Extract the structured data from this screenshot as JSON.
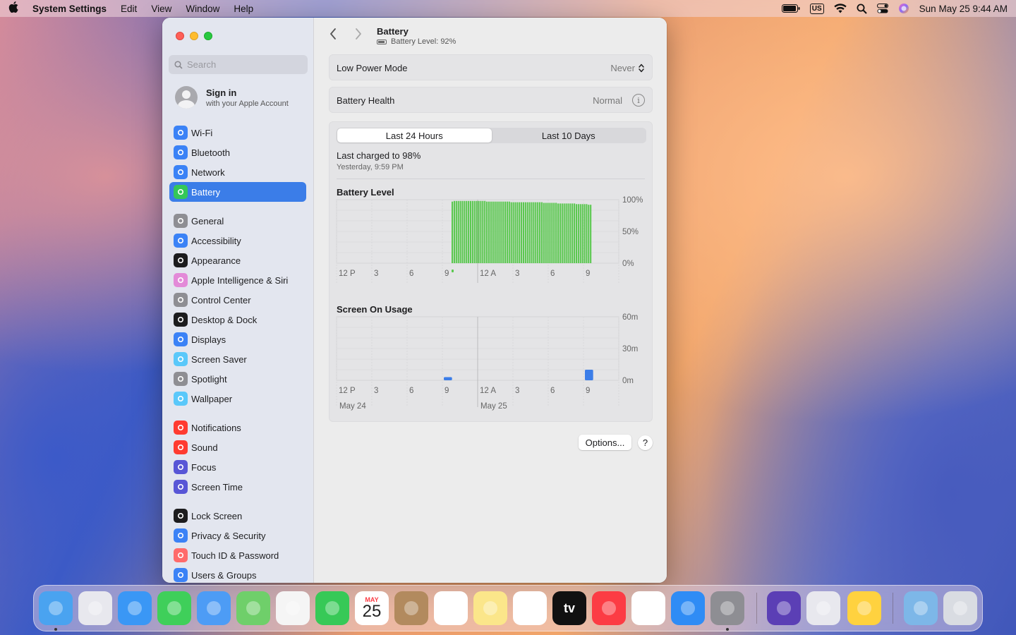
{
  "menubar": {
    "app_name": "System Settings",
    "menus": [
      "Edit",
      "View",
      "Window",
      "Help"
    ],
    "input_source": "US",
    "datetime": "Sun May 25  9:44 AM"
  },
  "sidebar": {
    "search_placeholder": "Search",
    "signin_title": "Sign in",
    "signin_subtitle": "with your Apple Account",
    "items": [
      {
        "label": "Wi-Fi",
        "icon": "wifi-icon",
        "color": "#3b82f6"
      },
      {
        "label": "Bluetooth",
        "icon": "bluetooth-icon",
        "color": "#3b82f6"
      },
      {
        "label": "Network",
        "icon": "globe-icon",
        "color": "#3b82f6"
      },
      {
        "label": "Battery",
        "icon": "battery-icon",
        "color": "#34c759",
        "active": true
      },
      {
        "label": "General",
        "icon": "gear-icon",
        "color": "#8e8e93"
      },
      {
        "label": "Accessibility",
        "icon": "accessibility-icon",
        "color": "#3b82f6"
      },
      {
        "label": "Appearance",
        "icon": "appearance-icon",
        "color": "#1c1c1e"
      },
      {
        "label": "Apple Intelligence & Siri",
        "icon": "siri-icon",
        "color": "#e38ad8"
      },
      {
        "label": "Control Center",
        "icon": "control-center-icon",
        "color": "#8e8e93"
      },
      {
        "label": "Desktop & Dock",
        "icon": "dock-icon",
        "color": "#1c1c1e"
      },
      {
        "label": "Displays",
        "icon": "sun-icon",
        "color": "#3b82f6"
      },
      {
        "label": "Screen Saver",
        "icon": "screen-saver-icon",
        "color": "#5ac8fa"
      },
      {
        "label": "Spotlight",
        "icon": "magnifier-icon",
        "color": "#8e8e93"
      },
      {
        "label": "Wallpaper",
        "icon": "flower-icon",
        "color": "#5ac8fa"
      },
      {
        "label": "Notifications",
        "icon": "bell-icon",
        "color": "#ff3b30"
      },
      {
        "label": "Sound",
        "icon": "speaker-icon",
        "color": "#ff3b30"
      },
      {
        "label": "Focus",
        "icon": "moon-icon",
        "color": "#5856d6"
      },
      {
        "label": "Screen Time",
        "icon": "hourglass-icon",
        "color": "#5856d6"
      },
      {
        "label": "Lock Screen",
        "icon": "lock-icon",
        "color": "#1c1c1e"
      },
      {
        "label": "Privacy & Security",
        "icon": "hand-icon",
        "color": "#3b82f6"
      },
      {
        "label": "Touch ID & Password",
        "icon": "fingerprint-icon",
        "color": "#ff6b6b"
      },
      {
        "label": "Users & Groups",
        "icon": "users-icon",
        "color": "#3b82f6"
      }
    ]
  },
  "header": {
    "title": "Battery",
    "subtitle": "Battery Level: 92%"
  },
  "low_power": {
    "label": "Low Power Mode",
    "value": "Never"
  },
  "battery_health": {
    "label": "Battery Health",
    "value": "Normal"
  },
  "usage": {
    "tabs": [
      "Last 24 Hours",
      "Last 10 Days"
    ],
    "selected_tab": 0,
    "last_charged": "Last charged to 98%",
    "last_charged_time": "Yesterday, 9:59 PM"
  },
  "chart_data": [
    {
      "type": "bar",
      "title": "Battery Level",
      "x_ticks": [
        "12 P",
        "3",
        "6",
        "9",
        "12 A",
        "3",
        "6",
        "9"
      ],
      "y_ticks": [
        "100%",
        "50%",
        "0%"
      ],
      "ylim": [
        0,
        100
      ],
      "color": "#5ac84f",
      "series": [
        {
          "values": [
            97,
            98,
            98,
            98,
            98,
            98,
            98,
            98,
            98,
            98,
            98,
            98,
            98,
            98,
            98,
            98,
            98,
            97,
            97,
            97,
            97,
            97,
            97,
            97,
            97,
            97,
            97,
            97,
            97,
            96,
            96,
            96,
            96,
            96,
            96,
            96,
            96,
            96,
            96,
            96,
            96,
            96,
            96,
            96,
            96,
            95,
            95,
            95,
            95,
            95,
            95,
            95,
            94,
            94,
            94,
            94,
            94,
            94,
            94,
            94,
            94,
            93,
            93,
            93,
            93,
            93,
            93,
            92,
            92
          ]
        }
      ]
    },
    {
      "type": "bar",
      "title": "Screen On Usage",
      "x_ticks": [
        "12 P",
        "3",
        "6",
        "9",
        "12 A",
        "3",
        "6",
        "9"
      ],
      "x_dates": [
        "May 24",
        "May 25"
      ],
      "y_ticks": [
        "60m",
        "30m",
        "0m"
      ],
      "ylim": [
        0,
        60
      ],
      "color": "#3b7de8",
      "series": [
        {
          "values": [
            {
              "slot": 9,
              "minutes": 3
            },
            {
              "slot": 21,
              "minutes": 10
            }
          ]
        }
      ]
    }
  ],
  "buttons": {
    "options": "Options...",
    "help": "?"
  },
  "dock": {
    "apps": [
      {
        "name": "Finder",
        "icon": "finder-icon",
        "color": "#4aa3f0",
        "running": true
      },
      {
        "name": "Launchpad",
        "icon": "launchpad-icon",
        "color": "#e8e8ee"
      },
      {
        "name": "Safari",
        "icon": "safari-icon",
        "color": "#3a97f5"
      },
      {
        "name": "Messages",
        "icon": "messages-icon",
        "color": "#3fcf5a"
      },
      {
        "name": "Mail",
        "icon": "mail-icon",
        "color": "#4d9cf5"
      },
      {
        "name": "Maps",
        "icon": "maps-icon",
        "color": "#6fcf6a"
      },
      {
        "name": "Photos",
        "icon": "photos-icon",
        "color": "#f5f5f5"
      },
      {
        "name": "FaceTime",
        "icon": "facetime-icon",
        "color": "#37c957"
      },
      {
        "name": "Calendar",
        "icon": "calendar-icon",
        "color": "#ffffff"
      },
      {
        "name": "Contacts",
        "icon": "contacts-icon",
        "color": "#b28a5e"
      },
      {
        "name": "Reminders",
        "icon": "reminders-icon",
        "color": "#ffffff"
      },
      {
        "name": "Notes",
        "icon": "notes-icon",
        "color": "#fbe68a"
      },
      {
        "name": "Freeform",
        "icon": "freeform-icon",
        "color": "#ffffff"
      },
      {
        "name": "TV",
        "icon": "tv-icon",
        "color": "#111111"
      },
      {
        "name": "Music",
        "icon": "music-icon",
        "color": "#fc3c44"
      },
      {
        "name": "News",
        "icon": "news-icon",
        "color": "#ffffff"
      },
      {
        "name": "App Store",
        "icon": "app-store-icon",
        "color": "#2f8cf5"
      },
      {
        "name": "System Settings",
        "icon": "system-settings-icon",
        "color": "#8e8e93",
        "running": true
      },
      {
        "name": "App",
        "icon": "purple-app-icon",
        "color": "#5b3fb5"
      },
      {
        "name": "iPhone Mirroring",
        "icon": "iphone-icon",
        "color": "#e8e8ee"
      },
      {
        "name": "Tips",
        "icon": "lightbulb-icon",
        "color": "#ffd23f"
      },
      {
        "name": "Downloads",
        "icon": "downloads-folder-icon",
        "color": "#7db7e8"
      },
      {
        "name": "Trash",
        "icon": "trash-icon",
        "color": "#d9dce2"
      }
    ],
    "calendar_month": "MAY",
    "calendar_day": "25",
    "tv_label": "tv"
  }
}
